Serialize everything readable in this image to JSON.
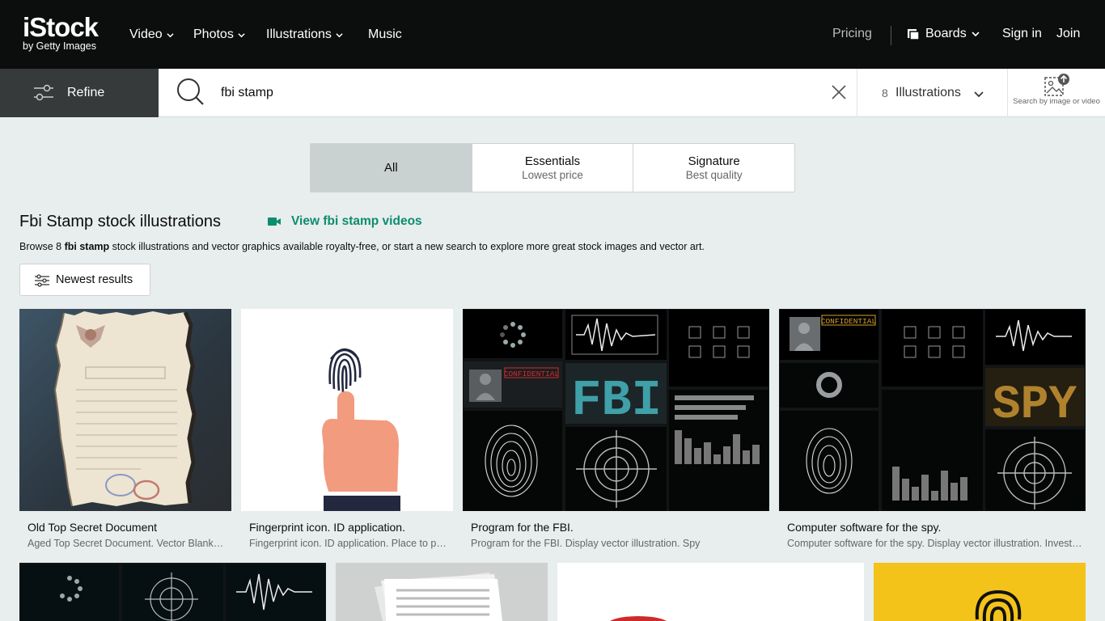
{
  "brand": {
    "logo_main": "iStock",
    "logo_sub": "by Getty Images"
  },
  "nav": {
    "video": "Video",
    "photos": "Photos",
    "illustrations": "Illustrations",
    "music": "Music",
    "pricing": "Pricing",
    "boards": "Boards",
    "sign_in": "Sign in",
    "join": "Join"
  },
  "search": {
    "refine_label": "Refine",
    "query": "fbi stamp",
    "result_count": "8",
    "asset_type": "Illustrations",
    "search_by_image": "Search by image or video"
  },
  "segments": [
    {
      "title": "All",
      "subtitle": ""
    },
    {
      "title": "Essentials",
      "subtitle": "Lowest price"
    },
    {
      "title": "Signature",
      "subtitle": "Best quality"
    }
  ],
  "page": {
    "title": "Fbi Stamp stock illustrations",
    "video_link": "View fbi stamp videos",
    "browse_pre": "Browse 8 ",
    "browse_term": "fbi stamp",
    "browse_post": " stock illustrations and vector graphics available royalty-free, or start a new search to explore more great stock images and vector art.",
    "sort_label": "Newest results"
  },
  "results": [
    {
      "title": "Old Top Secret Document",
      "desc": "Aged Top Secret Document. Vector Blank Template"
    },
    {
      "title": "Fingerprint icon. ID application.",
      "desc": "Fingerprint icon. ID application. Place to press"
    },
    {
      "title": "Program for the FBI.",
      "desc": "Program for the FBI. Display vector illustration. Spy"
    },
    {
      "title": "Computer software for the spy.",
      "desc": "Computer software for the spy. Display vector illustration. Investigation"
    }
  ],
  "image_text": {
    "confidential": "CONFIDENTIAL",
    "fbi": "FBI",
    "spy": "SPY"
  },
  "colors": {
    "accent": "#0b8d6f",
    "topbar": "#0c0d0d",
    "background": "#e8eded",
    "refine_bg": "#363a3a"
  }
}
